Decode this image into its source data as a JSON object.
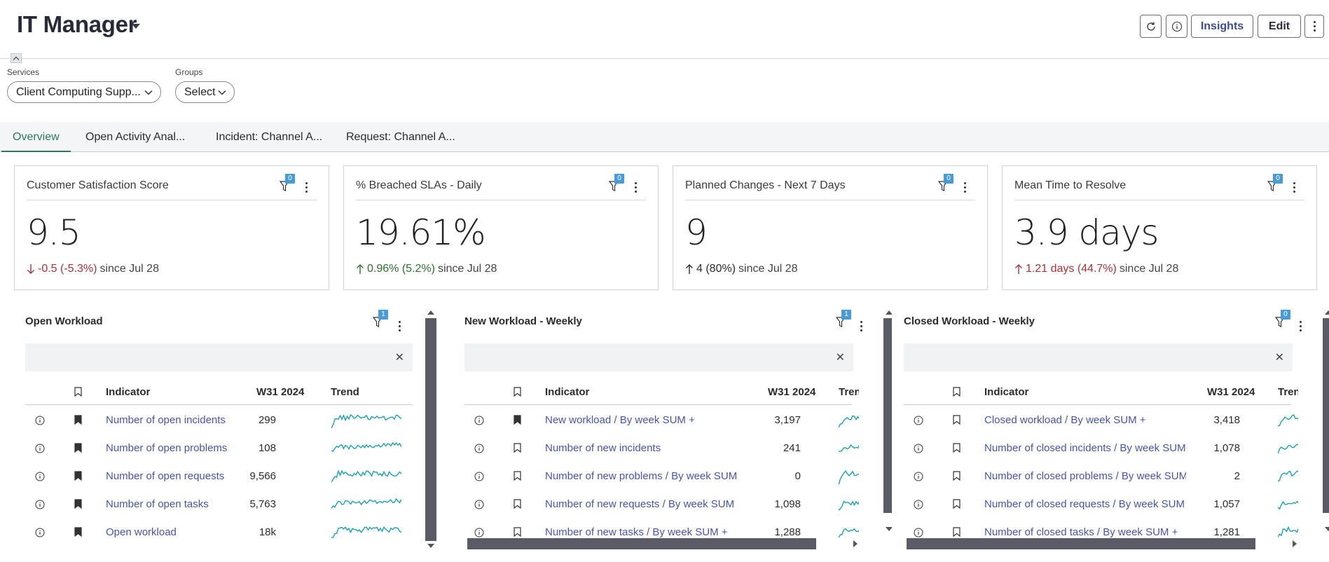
{
  "header": {
    "title": "IT Manager",
    "buttons": {
      "insights": "Insights",
      "edit": "Edit"
    }
  },
  "filters": {
    "services": {
      "label": "Services",
      "value": "Client Computing Supp..."
    },
    "groups": {
      "label": "Groups",
      "value": "Select"
    }
  },
  "tabs": [
    {
      "label": "Overview",
      "active": true
    },
    {
      "label": "Open Activity Anal..."
    },
    {
      "label": "Incident: Channel A..."
    },
    {
      "label": "Request: Channel A..."
    }
  ],
  "kpis": [
    {
      "title": "Customer Satisfaction Score",
      "filters": "0",
      "value": "9.5",
      "delta": "-0.5 (-5.3%)",
      "direction": "down",
      "tone": "red",
      "since": "since Jul 28"
    },
    {
      "title": "% Breached SLAs - Daily",
      "filters": "0",
      "value": "19.61%",
      "delta": "0.96% (5.2%)",
      "direction": "up",
      "tone": "green",
      "since": "since Jul 28"
    },
    {
      "title": "Planned Changes - Next 7 Days",
      "filters": "0",
      "value": "9",
      "delta": "4 (80%)",
      "direction": "up",
      "tone": "grey",
      "since": "since Jul 28"
    },
    {
      "title": "Mean Time to Resolve",
      "filters": "0",
      "value": "3.9 days",
      "delta": "1.21 days (44.7%)",
      "direction": "up",
      "tone": "red",
      "since": "since Jul 28"
    }
  ],
  "widgets": [
    {
      "title": "Open Workload",
      "filters": "1",
      "columns": {
        "indicator": "Indicator",
        "period": "W31 2024",
        "trend": "Trend"
      },
      "rows": [
        {
          "indicator": "Number of open incidents",
          "value": "299",
          "bookmarked": true
        },
        {
          "indicator": "Number of open problems",
          "value": "108",
          "bookmarked": true
        },
        {
          "indicator": "Number of open requests",
          "value": "9,566",
          "bookmarked": true
        },
        {
          "indicator": "Number of open tasks",
          "value": "5,763",
          "bookmarked": true
        },
        {
          "indicator": "Open workload",
          "value": "18k",
          "bookmarked": true
        }
      ]
    },
    {
      "title": "New Workload - Weekly",
      "filters": "1",
      "columns": {
        "indicator": "Indicator",
        "period": "W31 2024",
        "trend": "Trend"
      },
      "rows": [
        {
          "indicator": "New workload / By week SUM +",
          "value": "3,197",
          "bookmarked": true
        },
        {
          "indicator": "Number of new incidents",
          "value": "241",
          "bookmarked": false
        },
        {
          "indicator": "Number of new problems / By week SUM",
          "value": "0",
          "bookmarked": false
        },
        {
          "indicator": "Number of new requests / By week SUM",
          "value": "1,098",
          "bookmarked": false
        },
        {
          "indicator": "Number of new tasks / By week SUM +",
          "value": "1,288",
          "bookmarked": false
        }
      ]
    },
    {
      "title": "Closed Workload - Weekly",
      "filters": "0",
      "columns": {
        "indicator": "Indicator",
        "period": "W31 2024",
        "trend": "Trend"
      },
      "rows": [
        {
          "indicator": "Closed workload / By week SUM +",
          "value": "3,418",
          "bookmarked": false
        },
        {
          "indicator": "Number of closed incidents / By week SUM",
          "value": "1,078",
          "bookmarked": false
        },
        {
          "indicator": "Number of closed problems / By week SUM",
          "value": "2",
          "bookmarked": false
        },
        {
          "indicator": "Number of closed requests / By week SUM",
          "value": "1,057",
          "bookmarked": false
        },
        {
          "indicator": "Number of closed tasks / By week SUM +",
          "value": "1,281",
          "bookmarked": false
        }
      ]
    }
  ],
  "colors": {
    "accent": "#2c7a55",
    "link": "#4656a3",
    "badge": "#4a9ad4",
    "spark": "#1f9fb0",
    "negative": "#a6323a",
    "positive": "#2e6f2e"
  }
}
